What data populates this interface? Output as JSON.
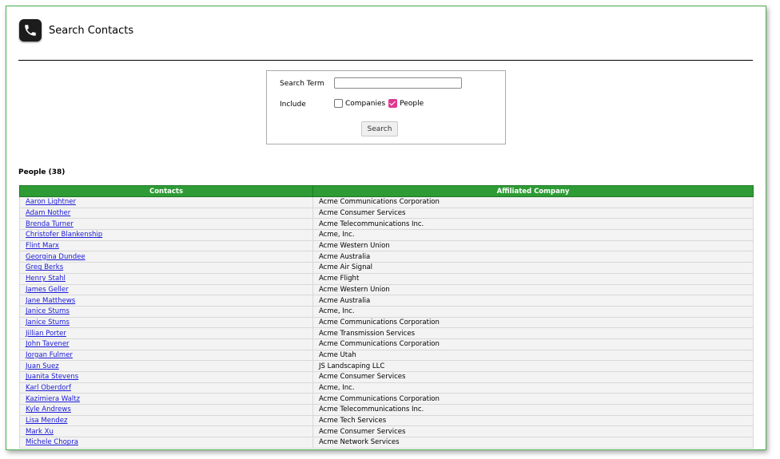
{
  "header": {
    "title": "Search Contacts",
    "icon": "phone-icon"
  },
  "search": {
    "term_label": "Search Term",
    "term_value": "",
    "term_placeholder": "",
    "include_label": "Include",
    "companies_label": "Companies",
    "companies_checked": false,
    "people_label": "People",
    "people_checked": true,
    "button_label": "Search"
  },
  "results": {
    "title": "People (38)",
    "columns": [
      "Contacts",
      "Affiliated Company"
    ],
    "rows": [
      [
        "Aaron Lightner",
        "Acme Communications Corporation"
      ],
      [
        "Adam Nother",
        "Acme Consumer Services"
      ],
      [
        "Brenda Turner",
        "Acme Telecommunications Inc."
      ],
      [
        "Christofer Blankenship",
        "Acme, Inc."
      ],
      [
        "Flint Marx",
        "Acme Western Union"
      ],
      [
        "Georgina Dundee",
        "Acme Australia"
      ],
      [
        "Greg Berks",
        "Acme Air Signal"
      ],
      [
        "Henry Stahl",
        "Acme Flight"
      ],
      [
        "James Geller",
        "Acme Western Union"
      ],
      [
        "Jane Matthews",
        "Acme Australia"
      ],
      [
        "Janice Stums",
        "Acme, Inc."
      ],
      [
        "Janice Stums",
        "Acme Communications Corporation"
      ],
      [
        "Jillian Porter",
        "Acme Transmission Services"
      ],
      [
        "John Tavener",
        "Acme Communications Corporation"
      ],
      [
        "Jorgan Fulmer",
        "Acme Utah"
      ],
      [
        "Juan Suez",
        "JS Landscaping LLC"
      ],
      [
        "Juanita Stevens",
        "Acme Consumer Services"
      ],
      [
        "Karl Oberdorf",
        "Acme, Inc."
      ],
      [
        "Kazimiera Waltz",
        "Acme Communications Corporation"
      ],
      [
        "Kyle Andrews",
        "Acme Telecommunications Inc."
      ],
      [
        "Lisa Mendez",
        "Acme Tech Services"
      ],
      [
        "Mark Xu",
        "Acme Consumer Services"
      ],
      [
        "Michele Chopra",
        "Acme Network Services"
      ]
    ]
  },
  "colors": {
    "header_green": "#2e9b35",
    "link_blue": "#1a1ad6",
    "checkbox_pink": "#e0388f"
  }
}
